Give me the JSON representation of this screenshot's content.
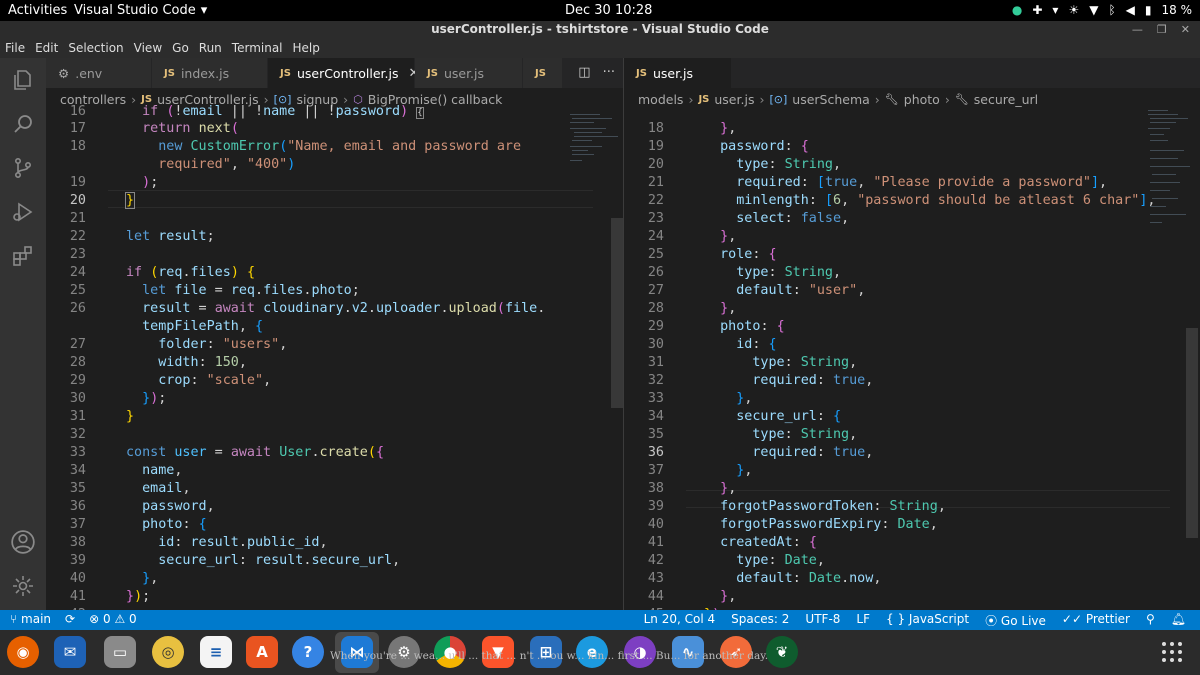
{
  "system": {
    "activities": "Activities",
    "app_name": "Visual Studio Code",
    "clock": "Dec 30  10:28",
    "battery": "18 %"
  },
  "window": {
    "title": "userController.js - tshirtstore - Visual Studio Code"
  },
  "menu": [
    "File",
    "Edit",
    "Selection",
    "View",
    "Go",
    "Run",
    "Terminal",
    "Help"
  ],
  "left_editor": {
    "tabs": [
      {
        "icon": "gear",
        "label": ".env"
      },
      {
        "icon": "JS",
        "label": "index.js"
      },
      {
        "icon": "JS",
        "label": "userController.js"
      },
      {
        "icon": "JS",
        "label": "user.js"
      },
      {
        "icon": "JS",
        "label": ""
      }
    ],
    "breadcrumb": [
      "controllers",
      "userController.js",
      "signup",
      "BigPromise() callback"
    ]
  },
  "right_editor": {
    "tabs": [
      {
        "icon": "JS",
        "label": "user.js"
      }
    ],
    "breadcrumb": [
      "models",
      "user.js",
      "userSchema",
      "photo",
      "secure_url"
    ]
  },
  "status": {
    "branch": "main",
    "problems": "0",
    "warnings": "0",
    "position": "Ln 20, Col 4",
    "spaces": "Spaces: 2",
    "encoding": "UTF-8",
    "eol": "LF",
    "language": "JavaScript",
    "golive": "Go Live",
    "prettier": "Prettier"
  },
  "dock": {
    "notification": "When you're ... wea... u'll ... that ... n't ... ou w... kin... first ... Bu... for another day."
  },
  "colors": {
    "statusbar": "#007acc",
    "editor_bg": "#1e1e1e",
    "activitybar": "#333333"
  }
}
